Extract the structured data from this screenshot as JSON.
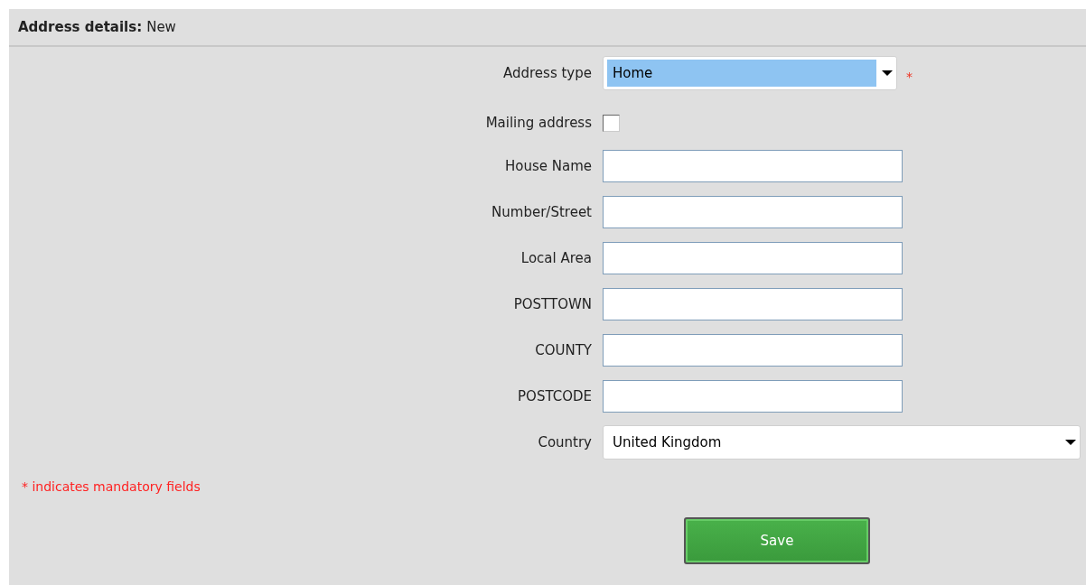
{
  "header": {
    "title": "Address details:",
    "status": "New"
  },
  "fields": [
    {
      "kind": "select",
      "label": "Address type",
      "value": "Home",
      "highlighted": true,
      "required": true,
      "required_mark": "*",
      "wide": false
    },
    {
      "kind": "checkbox",
      "label": "Mailing address",
      "checked": false
    },
    {
      "kind": "text",
      "label": "House Name"
    },
    {
      "kind": "text",
      "label": "Number/Street"
    },
    {
      "kind": "text",
      "label": "Local Area"
    },
    {
      "kind": "text",
      "label": "POSTTOWN"
    },
    {
      "kind": "text",
      "label": "COUNTY"
    },
    {
      "kind": "text",
      "label": "POSTCODE"
    },
    {
      "kind": "select",
      "label": "Country",
      "value": "United Kingdom",
      "highlighted": false,
      "required": false,
      "wide": true
    }
  ],
  "note": "* indicates mandatory fields",
  "save_button": "Save"
}
